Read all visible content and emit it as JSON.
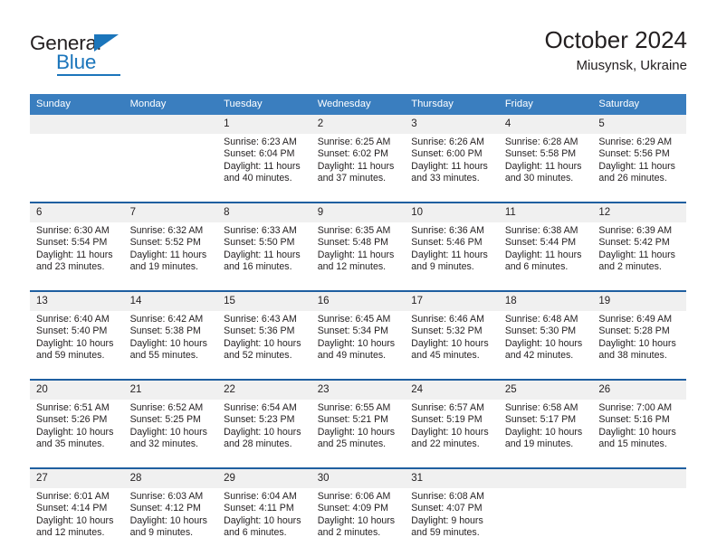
{
  "logo": {
    "general_text": "General",
    "blue_text": "Blue",
    "triangle_color": "#1b75bb"
  },
  "header": {
    "title": "October 2024",
    "subtitle": "Miusynsk, Ukraine"
  },
  "theme": {
    "header_blue": "#3a7ebf",
    "separator_blue": "#1f5fa0",
    "daynum_bg": "#f0f0f0",
    "text": "#231f20"
  },
  "weekday_headers": [
    "Sunday",
    "Monday",
    "Tuesday",
    "Wednesday",
    "Thursday",
    "Friday",
    "Saturday"
  ],
  "labels": {
    "sunrise_prefix": "Sunrise:",
    "sunset_prefix": "Sunset:",
    "daylight_prefix": "Daylight:"
  },
  "weeks": [
    {
      "days": [
        {
          "num": "",
          "sunrise": "",
          "sunset": "",
          "daylight_line1": "",
          "daylight_line2": "",
          "empty": true
        },
        {
          "num": "",
          "sunrise": "",
          "sunset": "",
          "daylight_line1": "",
          "daylight_line2": "",
          "empty": true
        },
        {
          "num": "1",
          "sunrise": "Sunrise: 6:23 AM",
          "sunset": "Sunset: 6:04 PM",
          "daylight_line1": "Daylight: 11 hours",
          "daylight_line2": "and 40 minutes.",
          "empty": false
        },
        {
          "num": "2",
          "sunrise": "Sunrise: 6:25 AM",
          "sunset": "Sunset: 6:02 PM",
          "daylight_line1": "Daylight: 11 hours",
          "daylight_line2": "and 37 minutes.",
          "empty": false
        },
        {
          "num": "3",
          "sunrise": "Sunrise: 6:26 AM",
          "sunset": "Sunset: 6:00 PM",
          "daylight_line1": "Daylight: 11 hours",
          "daylight_line2": "and 33 minutes.",
          "empty": false
        },
        {
          "num": "4",
          "sunrise": "Sunrise: 6:28 AM",
          "sunset": "Sunset: 5:58 PM",
          "daylight_line1": "Daylight: 11 hours",
          "daylight_line2": "and 30 minutes.",
          "empty": false
        },
        {
          "num": "5",
          "sunrise": "Sunrise: 6:29 AM",
          "sunset": "Sunset: 5:56 PM",
          "daylight_line1": "Daylight: 11 hours",
          "daylight_line2": "and 26 minutes.",
          "empty": false
        }
      ]
    },
    {
      "days": [
        {
          "num": "6",
          "sunrise": "Sunrise: 6:30 AM",
          "sunset": "Sunset: 5:54 PM",
          "daylight_line1": "Daylight: 11 hours",
          "daylight_line2": "and 23 minutes.",
          "empty": false
        },
        {
          "num": "7",
          "sunrise": "Sunrise: 6:32 AM",
          "sunset": "Sunset: 5:52 PM",
          "daylight_line1": "Daylight: 11 hours",
          "daylight_line2": "and 19 minutes.",
          "empty": false
        },
        {
          "num": "8",
          "sunrise": "Sunrise: 6:33 AM",
          "sunset": "Sunset: 5:50 PM",
          "daylight_line1": "Daylight: 11 hours",
          "daylight_line2": "and 16 minutes.",
          "empty": false
        },
        {
          "num": "9",
          "sunrise": "Sunrise: 6:35 AM",
          "sunset": "Sunset: 5:48 PM",
          "daylight_line1": "Daylight: 11 hours",
          "daylight_line2": "and 12 minutes.",
          "empty": false
        },
        {
          "num": "10",
          "sunrise": "Sunrise: 6:36 AM",
          "sunset": "Sunset: 5:46 PM",
          "daylight_line1": "Daylight: 11 hours",
          "daylight_line2": "and 9 minutes.",
          "empty": false
        },
        {
          "num": "11",
          "sunrise": "Sunrise: 6:38 AM",
          "sunset": "Sunset: 5:44 PM",
          "daylight_line1": "Daylight: 11 hours",
          "daylight_line2": "and 6 minutes.",
          "empty": false
        },
        {
          "num": "12",
          "sunrise": "Sunrise: 6:39 AM",
          "sunset": "Sunset: 5:42 PM",
          "daylight_line1": "Daylight: 11 hours",
          "daylight_line2": "and 2 minutes.",
          "empty": false
        }
      ]
    },
    {
      "days": [
        {
          "num": "13",
          "sunrise": "Sunrise: 6:40 AM",
          "sunset": "Sunset: 5:40 PM",
          "daylight_line1": "Daylight: 10 hours",
          "daylight_line2": "and 59 minutes.",
          "empty": false
        },
        {
          "num": "14",
          "sunrise": "Sunrise: 6:42 AM",
          "sunset": "Sunset: 5:38 PM",
          "daylight_line1": "Daylight: 10 hours",
          "daylight_line2": "and 55 minutes.",
          "empty": false
        },
        {
          "num": "15",
          "sunrise": "Sunrise: 6:43 AM",
          "sunset": "Sunset: 5:36 PM",
          "daylight_line1": "Daylight: 10 hours",
          "daylight_line2": "and 52 minutes.",
          "empty": false
        },
        {
          "num": "16",
          "sunrise": "Sunrise: 6:45 AM",
          "sunset": "Sunset: 5:34 PM",
          "daylight_line1": "Daylight: 10 hours",
          "daylight_line2": "and 49 minutes.",
          "empty": false
        },
        {
          "num": "17",
          "sunrise": "Sunrise: 6:46 AM",
          "sunset": "Sunset: 5:32 PM",
          "daylight_line1": "Daylight: 10 hours",
          "daylight_line2": "and 45 minutes.",
          "empty": false
        },
        {
          "num": "18",
          "sunrise": "Sunrise: 6:48 AM",
          "sunset": "Sunset: 5:30 PM",
          "daylight_line1": "Daylight: 10 hours",
          "daylight_line2": "and 42 minutes.",
          "empty": false
        },
        {
          "num": "19",
          "sunrise": "Sunrise: 6:49 AM",
          "sunset": "Sunset: 5:28 PM",
          "daylight_line1": "Daylight: 10 hours",
          "daylight_line2": "and 38 minutes.",
          "empty": false
        }
      ]
    },
    {
      "days": [
        {
          "num": "20",
          "sunrise": "Sunrise: 6:51 AM",
          "sunset": "Sunset: 5:26 PM",
          "daylight_line1": "Daylight: 10 hours",
          "daylight_line2": "and 35 minutes.",
          "empty": false
        },
        {
          "num": "21",
          "sunrise": "Sunrise: 6:52 AM",
          "sunset": "Sunset: 5:25 PM",
          "daylight_line1": "Daylight: 10 hours",
          "daylight_line2": "and 32 minutes.",
          "empty": false
        },
        {
          "num": "22",
          "sunrise": "Sunrise: 6:54 AM",
          "sunset": "Sunset: 5:23 PM",
          "daylight_line1": "Daylight: 10 hours",
          "daylight_line2": "and 28 minutes.",
          "empty": false
        },
        {
          "num": "23",
          "sunrise": "Sunrise: 6:55 AM",
          "sunset": "Sunset: 5:21 PM",
          "daylight_line1": "Daylight: 10 hours",
          "daylight_line2": "and 25 minutes.",
          "empty": false
        },
        {
          "num": "24",
          "sunrise": "Sunrise: 6:57 AM",
          "sunset": "Sunset: 5:19 PM",
          "daylight_line1": "Daylight: 10 hours",
          "daylight_line2": "and 22 minutes.",
          "empty": false
        },
        {
          "num": "25",
          "sunrise": "Sunrise: 6:58 AM",
          "sunset": "Sunset: 5:17 PM",
          "daylight_line1": "Daylight: 10 hours",
          "daylight_line2": "and 19 minutes.",
          "empty": false
        },
        {
          "num": "26",
          "sunrise": "Sunrise: 7:00 AM",
          "sunset": "Sunset: 5:16 PM",
          "daylight_line1": "Daylight: 10 hours",
          "daylight_line2": "and 15 minutes.",
          "empty": false
        }
      ]
    },
    {
      "days": [
        {
          "num": "27",
          "sunrise": "Sunrise: 6:01 AM",
          "sunset": "Sunset: 4:14 PM",
          "daylight_line1": "Daylight: 10 hours",
          "daylight_line2": "and 12 minutes.",
          "empty": false
        },
        {
          "num": "28",
          "sunrise": "Sunrise: 6:03 AM",
          "sunset": "Sunset: 4:12 PM",
          "daylight_line1": "Daylight: 10 hours",
          "daylight_line2": "and 9 minutes.",
          "empty": false
        },
        {
          "num": "29",
          "sunrise": "Sunrise: 6:04 AM",
          "sunset": "Sunset: 4:11 PM",
          "daylight_line1": "Daylight: 10 hours",
          "daylight_line2": "and 6 minutes.",
          "empty": false
        },
        {
          "num": "30",
          "sunrise": "Sunrise: 6:06 AM",
          "sunset": "Sunset: 4:09 PM",
          "daylight_line1": "Daylight: 10 hours",
          "daylight_line2": "and 2 minutes.",
          "empty": false
        },
        {
          "num": "31",
          "sunrise": "Sunrise: 6:08 AM",
          "sunset": "Sunset: 4:07 PM",
          "daylight_line1": "Daylight: 9 hours",
          "daylight_line2": "and 59 minutes.",
          "empty": false
        },
        {
          "num": "",
          "sunrise": "",
          "sunset": "",
          "daylight_line1": "",
          "daylight_line2": "",
          "empty": true
        },
        {
          "num": "",
          "sunrise": "",
          "sunset": "",
          "daylight_line1": "",
          "daylight_line2": "",
          "empty": true
        }
      ]
    }
  ]
}
